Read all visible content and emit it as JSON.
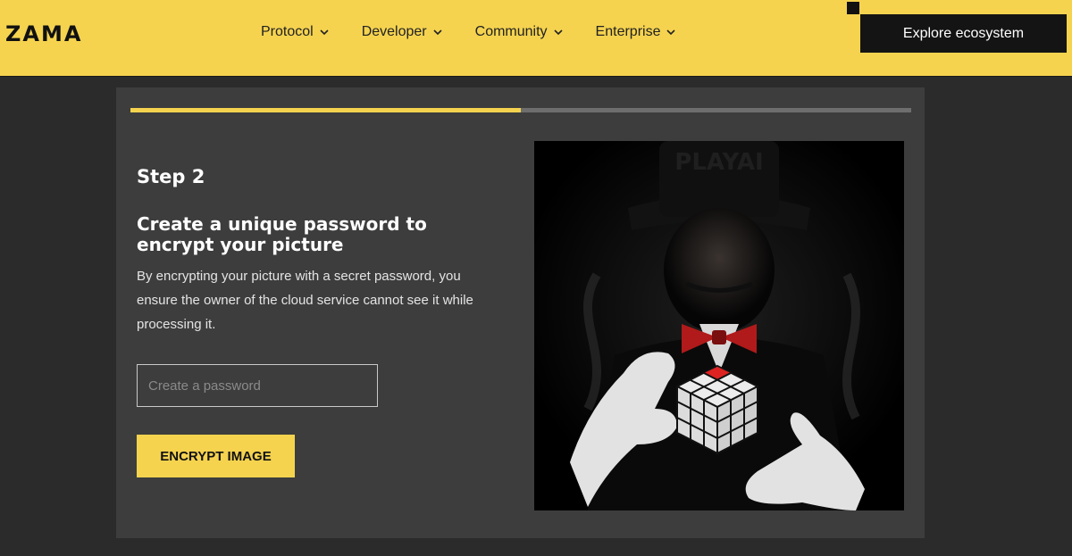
{
  "header": {
    "logo": "ZAMA",
    "nav": [
      {
        "label": "Protocol",
        "icon": "chevron-down-icon"
      },
      {
        "label": "Developer",
        "icon": "chevron-down-icon"
      },
      {
        "label": "Community",
        "icon": "chevron-down-icon"
      },
      {
        "label": "Enterprise",
        "icon": "chevron-down-icon"
      }
    ],
    "cta_label": "Explore ecosystem"
  },
  "main": {
    "progress_percent": 50,
    "step_label": "Step 2",
    "title": "Create a unique password to encrypt your picture",
    "description": "By encrypting your picture with a secret password, you ensure the owner of the cloud service cannot see it while processing it.",
    "password_placeholder": "Create a password",
    "password_value": "",
    "encrypt_button_label": "ENCRYPT IMAGE",
    "picture_hat_text": "PLAYAI"
  },
  "colors": {
    "brand_yellow": "#f5d34f",
    "page_background": "#2b2b2b",
    "card_background": "#3d3d3d",
    "cta_background": "#141414"
  }
}
